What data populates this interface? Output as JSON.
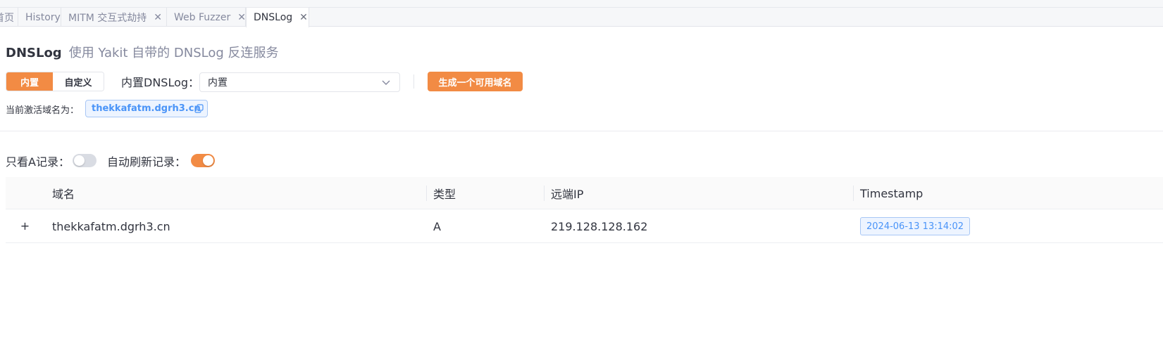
{
  "tabs": [
    {
      "label": "首页",
      "closable": false
    },
    {
      "label": "History",
      "closable": false
    },
    {
      "label": "MITM 交互式劫持",
      "closable": true
    },
    {
      "label": "Web Fuzzer",
      "closable": true
    },
    {
      "label": "DNSLog",
      "closable": true,
      "active": true
    }
  ],
  "tab_close_glyph": "✕",
  "header": {
    "title": "DNSLog",
    "subtitle": "使用 Yakit 自带的 DNSLog 反连服务"
  },
  "mode": {
    "options": [
      "内置",
      "自定义"
    ],
    "selected": "内置"
  },
  "builtin_dnslog": {
    "label": "内置DNSLog：",
    "value": "内置"
  },
  "generate_button": "生成一个可用域名",
  "current_domain": {
    "label": "当前激活域名为：",
    "value": "thekkafatm.dgrh3.cn"
  },
  "filters": {
    "only_a_label": "只看A记录：",
    "only_a_enabled": false,
    "auto_refresh_label": "自动刷新记录：",
    "auto_refresh_enabled": true
  },
  "table": {
    "columns": [
      "域名",
      "类型",
      "远端IP",
      "Timestamp"
    ],
    "rows": [
      {
        "domain": "thekkafatm.dgrh3.cn",
        "type": "A",
        "remote_ip": "219.128.128.162",
        "timestamp": "2024-06-13 13:14:02",
        "expand_glyph": "+"
      }
    ]
  },
  "colors": {
    "accent": "#f28b44",
    "tag_blue": "#4a94f8",
    "text": "#31343f",
    "muted": "#85899e"
  }
}
